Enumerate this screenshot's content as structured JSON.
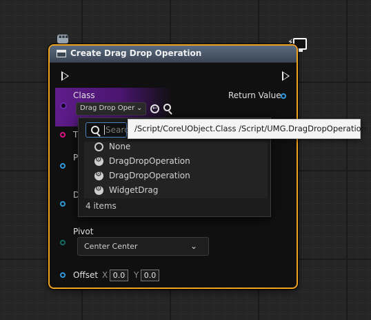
{
  "node": {
    "title": "Create Drag Drop Operation",
    "accent_color": "#f2a51e",
    "header_color": "#4b5869"
  },
  "pins": {
    "class_label": "Class",
    "class_value": "Drag Drop Oper",
    "return_label": "Return Value",
    "tag_initial": "T",
    "payload_initial": "P",
    "default_drag_initial": "D",
    "pivot_label": "Pivot",
    "pivot_value": "Center Center",
    "offset_label": "Offset",
    "offset_x_label": "X",
    "offset_x_value": "0.0",
    "offset_y_label": "Y",
    "offset_y_value": "0.0"
  },
  "picker": {
    "search_placeholder": "Search",
    "items": [
      {
        "label": "None",
        "icon": "none-circle-icon"
      },
      {
        "label": "DragDropOperation",
        "icon": "class-icon"
      },
      {
        "label": "DragDropOperation",
        "icon": "class-icon"
      },
      {
        "label": "WidgetDrag",
        "icon": "class-icon"
      }
    ],
    "count_text": "4 items"
  },
  "tooltip": {
    "text": "/Script/CoreUObject.Class /Script/UMG.DragDropOperation"
  },
  "colors": {
    "class_pin": "#6a2bb0",
    "tag_pin": "#e0138c",
    "object_pin": "#2f9bde",
    "pivot_pin": "#0f6d66"
  }
}
